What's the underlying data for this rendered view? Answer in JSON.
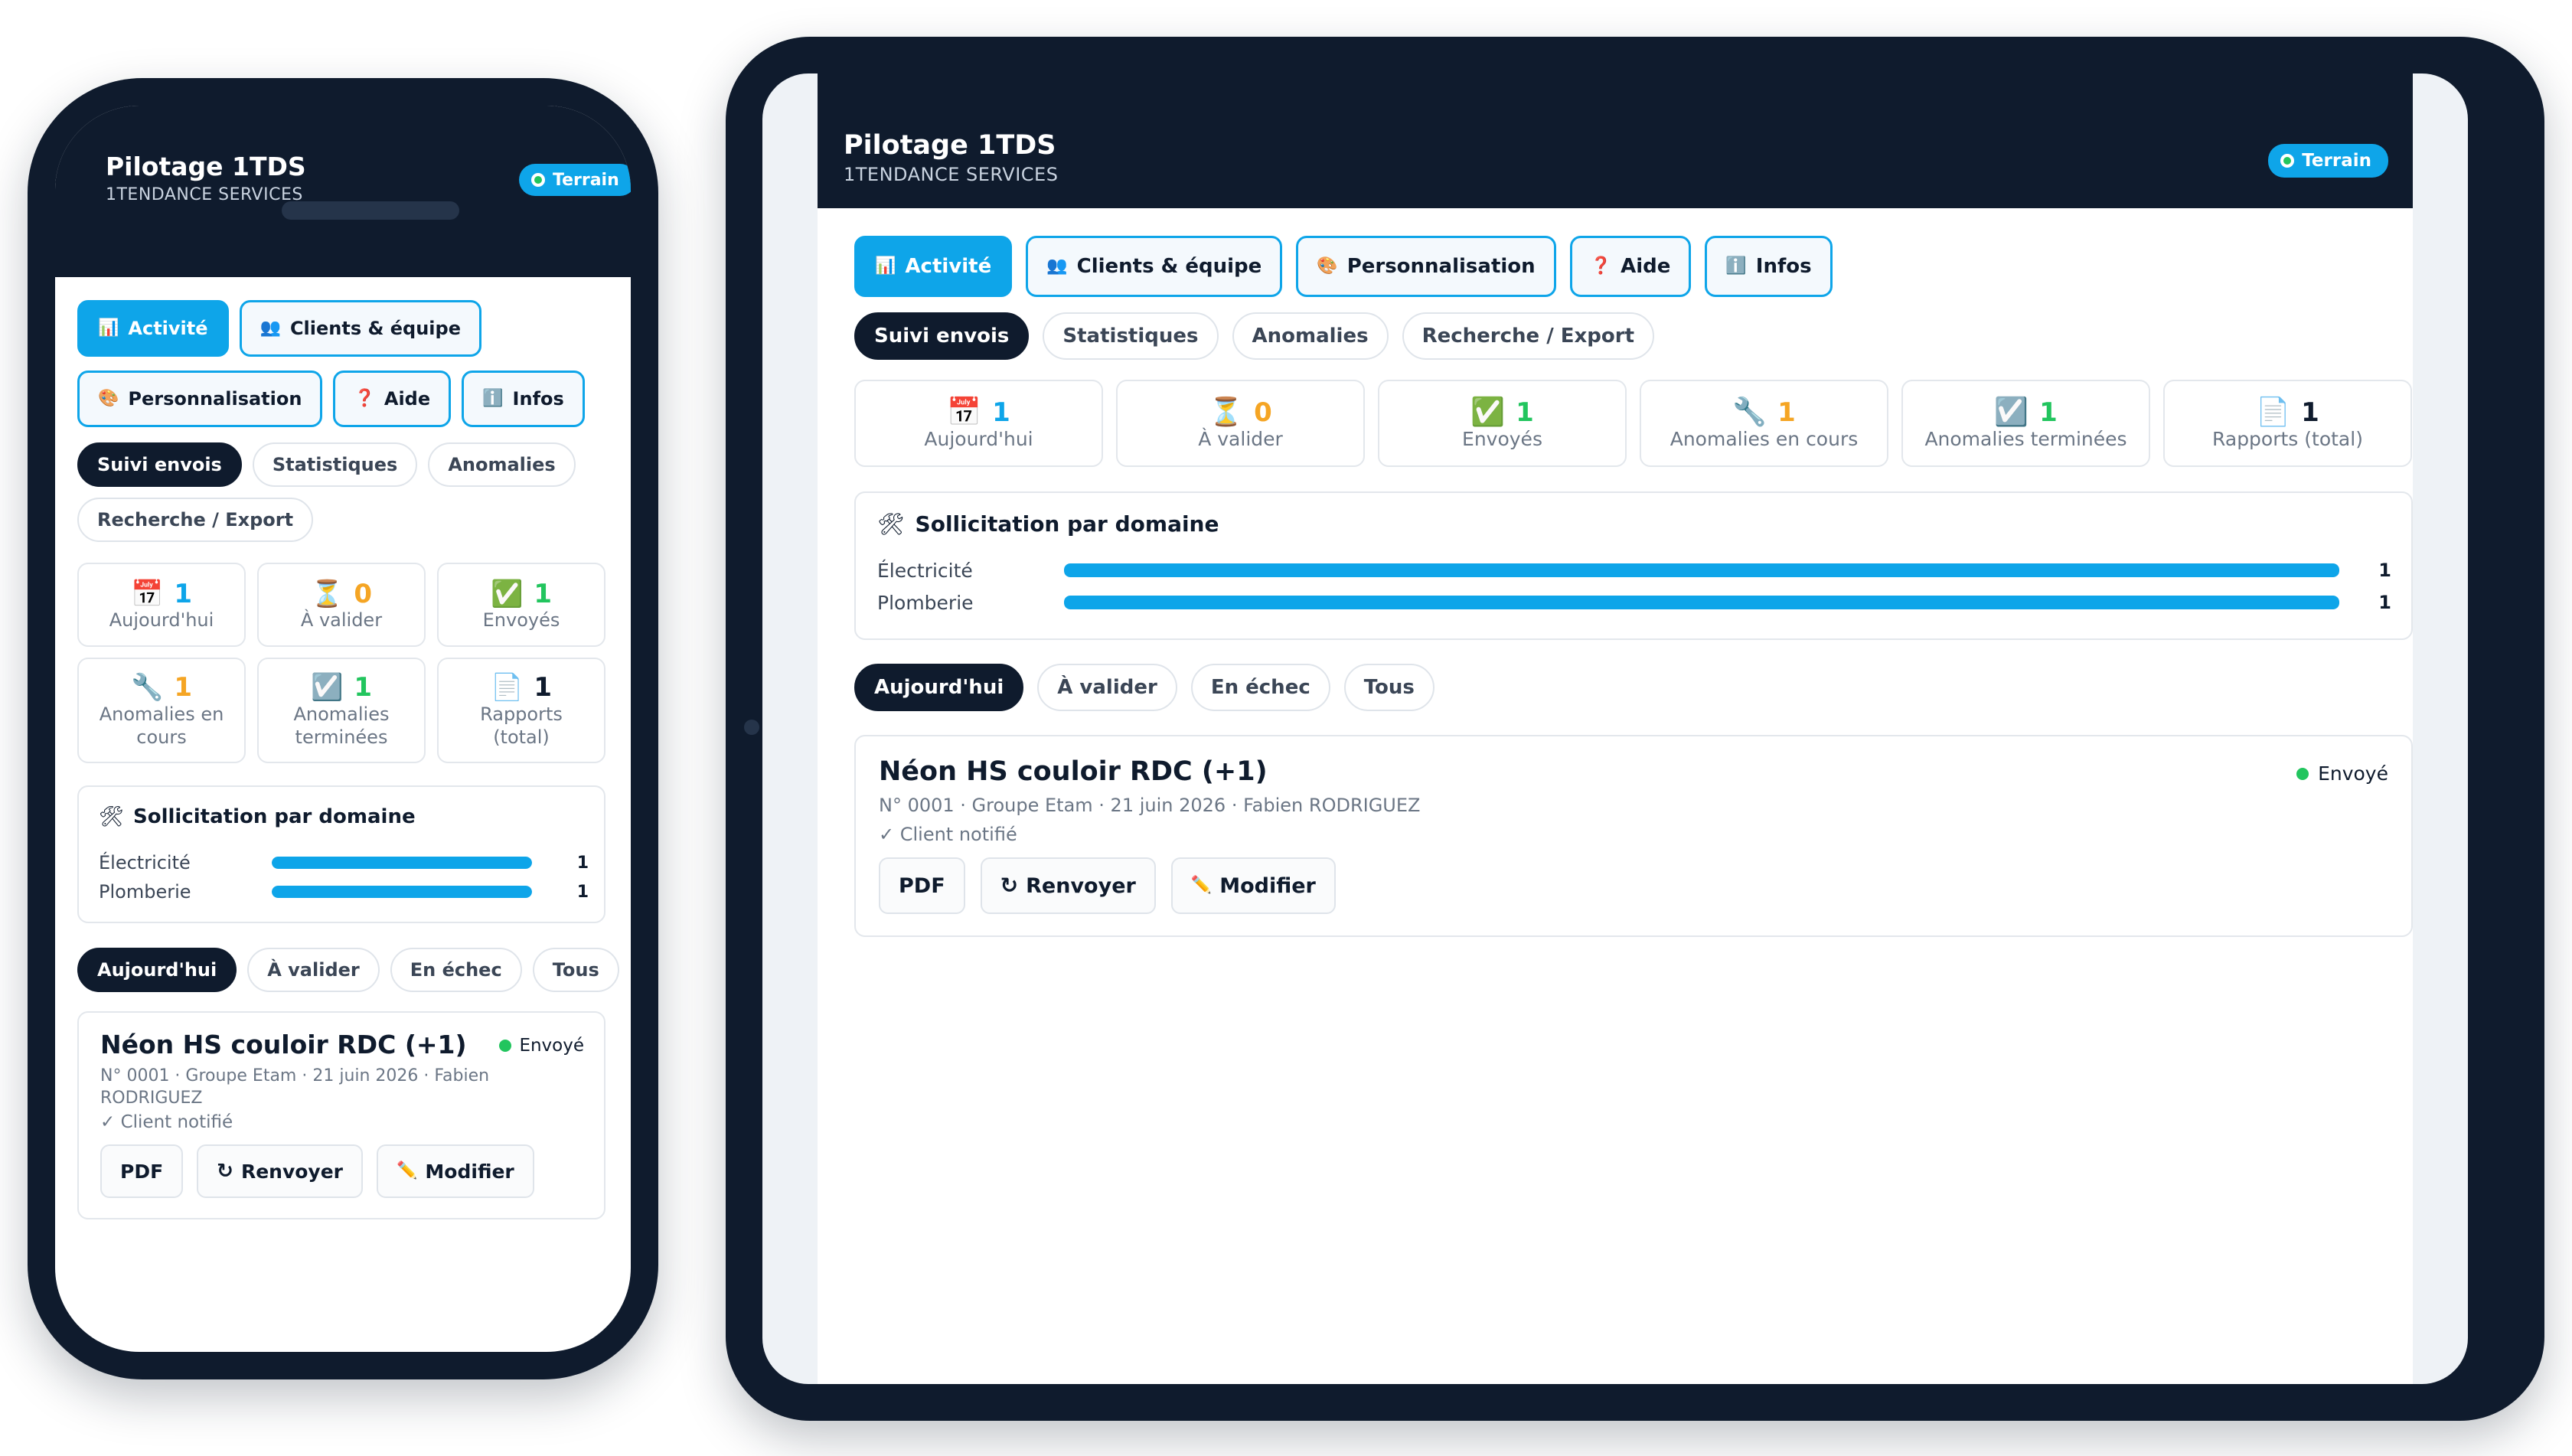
{
  "app": {
    "title": "Pilotage 1TDS",
    "subtitle": "1TENDANCE SERVICES",
    "mode_badge": "Terrain"
  },
  "main_tabs": [
    {
      "icon": "bar-chart-icon",
      "glyph": "📊",
      "label": "Activité",
      "active": true
    },
    {
      "icon": "people-icon",
      "glyph": "👥",
      "label": "Clients & équipe",
      "active": false
    },
    {
      "icon": "palette-icon",
      "glyph": "🎨",
      "label": "Personnalisation",
      "active": false
    },
    {
      "icon": "question-icon",
      "glyph": "❓",
      "label": "Aide",
      "active": false
    },
    {
      "icon": "info-icon",
      "glyph": "ℹ️",
      "label": "Infos",
      "active": false
    }
  ],
  "sub_tabs": [
    {
      "label": "Suivi envois",
      "active": true
    },
    {
      "label": "Statistiques",
      "active": false
    },
    {
      "label": "Anomalies",
      "active": false
    },
    {
      "label": "Recherche / Export",
      "active": false
    }
  ],
  "stats": [
    {
      "icon": "calendar-icon",
      "glyph": "📅",
      "value": "1",
      "color": "blue",
      "label": "Aujourd'hui"
    },
    {
      "icon": "hourglass-icon",
      "glyph": "⏳",
      "value": "0",
      "color": "orange",
      "label": "À valider"
    },
    {
      "icon": "checkbox-icon",
      "glyph": "✅",
      "value": "1",
      "color": "green",
      "label": "Envoyés"
    },
    {
      "icon": "wrench-icon",
      "glyph": "🔧",
      "value": "1",
      "color": "orange",
      "label": "Anomalies en cours"
    },
    {
      "icon": "check-square-icon",
      "glyph": "☑️",
      "value": "1",
      "color": "green",
      "label": "Anomalies terminées"
    },
    {
      "icon": "document-icon",
      "glyph": "📄",
      "value": "1",
      "color": "dark",
      "label": "Rapports (total)"
    }
  ],
  "domain_card": {
    "icon": "tools-icon",
    "glyph": "🛠",
    "title": "Sollicitation par domaine",
    "rows": [
      {
        "label": "Électricité",
        "value": "1",
        "fill": 1.0
      },
      {
        "label": "Plomberie",
        "value": "1",
        "fill": 1.0
      }
    ]
  },
  "filters": [
    {
      "label": "Aujourd'hui",
      "active": true
    },
    {
      "label": "À valider",
      "active": false
    },
    {
      "label": "En échec",
      "active": false
    },
    {
      "label": "Tous",
      "active": false
    }
  ],
  "report": {
    "title": "Néon HS couloir RDC (+1)",
    "meta": "N° 0001 · Groupe Etam · 21 juin 2026 · Fabien RODRIGUEZ",
    "notified": "✓ Client notifié",
    "status": "Envoyé",
    "status_color": "#22c55e",
    "actions": [
      {
        "icon": "",
        "glyph": "",
        "label": "PDF"
      },
      {
        "icon": "resend-icon",
        "glyph": "↻",
        "label": "Renvoyer"
      },
      {
        "icon": "pencil-icon",
        "glyph": "✏️",
        "label": "Modifier"
      }
    ]
  },
  "colors": {
    "accent": "#0ea5e9",
    "dark": "#0f1b2d",
    "success": "#22c55e",
    "warning": "#f5a524"
  }
}
